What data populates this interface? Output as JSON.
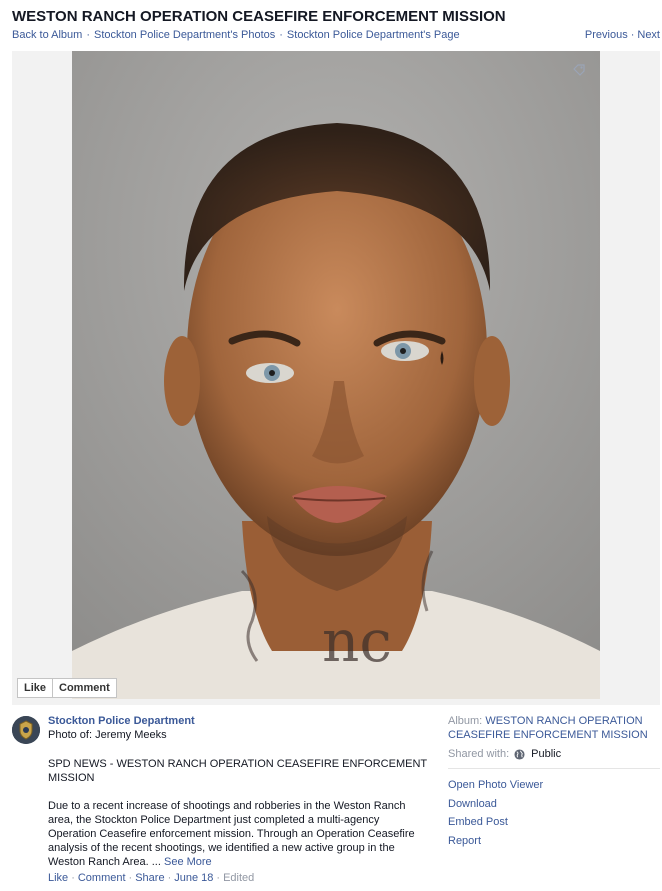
{
  "header": {
    "title": "WESTON RANCH OPERATION CEASEFIRE ENFORCEMENT MISSION",
    "breadcrumbs": [
      "Back to Album",
      "Stockton Police Department's Photos",
      "Stockton Police Department's Page"
    ],
    "separator": "·",
    "previous": "Previous",
    "next": "Next"
  },
  "photo": {
    "like_label": "Like",
    "comment_label": "Comment"
  },
  "post": {
    "page_name": "Stockton Police Department",
    "photo_of": "Photo of: Jeremy Meeks",
    "heading": "SPD NEWS - WESTON RANCH OPERATION CEASEFIRE ENFORCEMENT MISSION",
    "body": "Due to a recent increase of shootings and robberies in the Weston Ranch area, the Stockton Police Department just completed a multi-agency Operation Ceasefire enforcement mission. Through an Operation Ceasefire analysis of the recent shootings, we identified a new active group in the Weston Ranch Area. ...",
    "see_more": "See More",
    "actions": {
      "like": "Like",
      "comment": "Comment",
      "share": "Share",
      "date": "June 18",
      "edited": "Edited"
    }
  },
  "sidebar": {
    "album_label": "Album:",
    "album_name": "WESTON RANCH OPERATION CEASEFIRE ENFORCEMENT MISSION",
    "shared_label": "Shared with:",
    "shared_value": "Public",
    "links": [
      "Open Photo Viewer",
      "Download",
      "Embed Post",
      "Report"
    ]
  },
  "colors": {
    "link": "#3b5998",
    "muted": "#9197a3",
    "text": "#141823"
  }
}
